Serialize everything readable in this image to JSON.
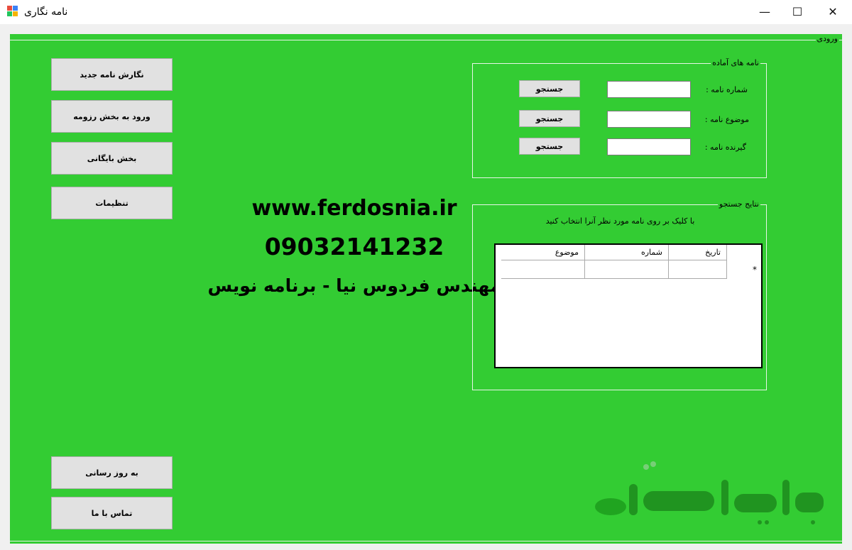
{
  "window": {
    "title": "نامه نگاری",
    "minimize_glyph": "—",
    "maximize_glyph": "☐",
    "close_glyph": "✕"
  },
  "frame": {
    "label": "ورودی"
  },
  "nav": {
    "new_letter": "نگارش نامه جدید",
    "journal": "ورود به بخش رزومه",
    "archive": "بخش بایگانی",
    "settings": "تنظیمات",
    "update": "به روز رسانی",
    "contact": "تماس با ما"
  },
  "watermark_text": {
    "website": "www.ferdosnia.ir",
    "phone": "09032141232",
    "engineer": "مهندس فردوس نیا - برنامه نویس"
  },
  "ready_letters": {
    "title": "نامه های آماده",
    "number_label": "شماره نامه :",
    "subject_label": "موضوع نامه :",
    "recipient_label": "گیرنده نامه :",
    "number_value": "",
    "subject_value": "",
    "recipient_value": "",
    "search_label": "جستجو"
  },
  "results": {
    "title": "نتایج جستجو",
    "hint": "با کلیک بر روی نامه مورد نظر آنرا انتخاب کنید",
    "columns": [
      "تاریخ",
      "شماره",
      "موضوع"
    ],
    "new_row_marker": "*"
  },
  "logo": {
    "text": "پاسخ"
  },
  "colors": {
    "background": "#33cc33",
    "button": "#e1e1e1"
  }
}
